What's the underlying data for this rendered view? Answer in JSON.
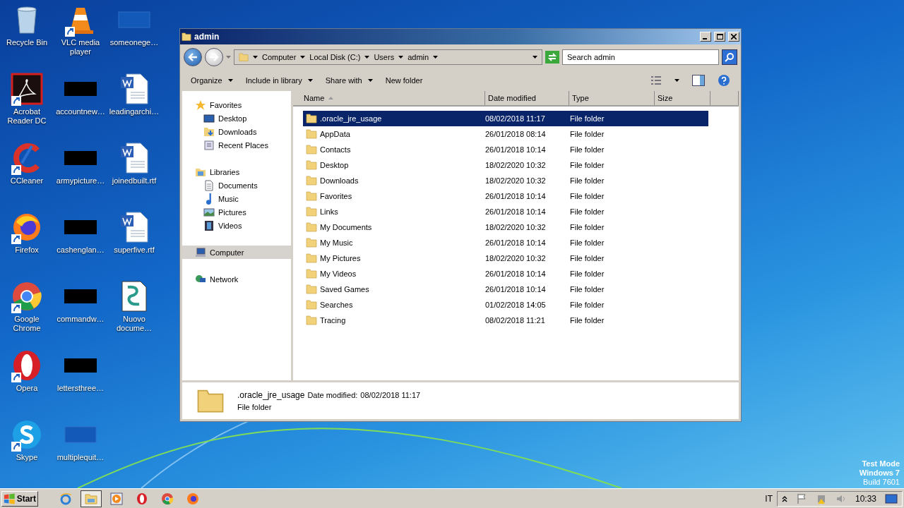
{
  "desktop_icons": [
    {
      "label": "Recycle Bin",
      "kind": "recycle",
      "shortcut": false
    },
    {
      "label": "Acrobat Reader DC",
      "kind": "acrobat",
      "shortcut": true
    },
    {
      "label": "CCleaner",
      "kind": "ccleaner",
      "shortcut": true
    },
    {
      "label": "Firefox",
      "kind": "firefox",
      "shortcut": true
    },
    {
      "label": "Google Chrome",
      "kind": "chrome",
      "shortcut": true
    },
    {
      "label": "Opera",
      "kind": "opera",
      "shortcut": true
    },
    {
      "label": "Skype",
      "kind": "skype",
      "shortcut": true
    },
    {
      "label": "VLC media player",
      "kind": "vlc",
      "shortcut": true
    },
    {
      "label": "accountnew…",
      "kind": "black",
      "shortcut": false
    },
    {
      "label": "armypicture…",
      "kind": "black",
      "shortcut": false
    },
    {
      "label": "cashenglan…",
      "kind": "black",
      "shortcut": false
    },
    {
      "label": "commandw…",
      "kind": "black",
      "shortcut": false
    },
    {
      "label": "lettersthree…",
      "kind": "black",
      "shortcut": false
    },
    {
      "label": "multiplequit…",
      "kind": "blank",
      "shortcut": false
    },
    {
      "label": "someonege…",
      "kind": "blank",
      "shortcut": false
    },
    {
      "label": "leadingarchi…",
      "kind": "word",
      "shortcut": false
    },
    {
      "label": "joinedbuilt.rtf",
      "kind": "word",
      "shortcut": false
    },
    {
      "label": "superfive.rtf",
      "kind": "word",
      "shortcut": false
    },
    {
      "label": "Nuovo docume…",
      "kind": "script",
      "shortcut": false
    }
  ],
  "window": {
    "title": "admin",
    "breadcrumb": [
      "Computer",
      "Local Disk (C:)",
      "Users",
      "admin"
    ],
    "search": {
      "placeholder": "Search admin"
    },
    "toolbar": [
      {
        "label": "Organize",
        "dropdown": true
      },
      {
        "label": "Include in library",
        "dropdown": true
      },
      {
        "label": "Share with",
        "dropdown": true
      },
      {
        "label": "New folder",
        "dropdown": false
      }
    ],
    "nav": [
      {
        "label": "Favorites",
        "kind": "star",
        "selected": false,
        "children": [
          {
            "label": "Desktop",
            "kind": "desktop",
            "selected": false
          },
          {
            "label": "Downloads",
            "kind": "downloads",
            "selected": false
          },
          {
            "label": "Recent Places",
            "kind": "recent",
            "selected": false
          }
        ]
      },
      {
        "label": "Libraries",
        "kind": "library",
        "selected": false,
        "children": [
          {
            "label": "Documents",
            "kind": "document",
            "selected": false
          },
          {
            "label": "Music",
            "kind": "music",
            "selected": false
          },
          {
            "label": "Pictures",
            "kind": "pictures",
            "selected": false
          },
          {
            "label": "Videos",
            "kind": "videos",
            "selected": false
          }
        ]
      },
      {
        "label": "Computer",
        "kind": "computer",
        "selected": true
      },
      {
        "label": "Network",
        "kind": "network",
        "selected": false
      }
    ],
    "columns": [
      {
        "label": "Name",
        "sorted": true
      },
      {
        "label": "Date modified",
        "sorted": false
      },
      {
        "label": "Type",
        "sorted": false
      },
      {
        "label": "Size",
        "sorted": false
      }
    ],
    "rows": [
      {
        "name": ".oracle_jre_usage",
        "date": "08/02/2018 11:17",
        "type": "File folder",
        "selected": true
      },
      {
        "name": "AppData",
        "date": "26/01/2018 08:14",
        "type": "File folder",
        "selected": false
      },
      {
        "name": "Contacts",
        "date": "26/01/2018 10:14",
        "type": "File folder",
        "selected": false
      },
      {
        "name": "Desktop",
        "date": "18/02/2020 10:32",
        "type": "File folder",
        "selected": false
      },
      {
        "name": "Downloads",
        "date": "18/02/2020 10:32",
        "type": "File folder",
        "selected": false
      },
      {
        "name": "Favorites",
        "date": "26/01/2018 10:14",
        "type": "File folder",
        "selected": false
      },
      {
        "name": "Links",
        "date": "26/01/2018 10:14",
        "type": "File folder",
        "selected": false
      },
      {
        "name": "My Documents",
        "date": "18/02/2020 10:32",
        "type": "File folder",
        "selected": false
      },
      {
        "name": "My Music",
        "date": "26/01/2018 10:14",
        "type": "File folder",
        "selected": false
      },
      {
        "name": "My Pictures",
        "date": "18/02/2020 10:32",
        "type": "File folder",
        "selected": false
      },
      {
        "name": "My Videos",
        "date": "26/01/2018 10:14",
        "type": "File folder",
        "selected": false
      },
      {
        "name": "Saved Games",
        "date": "26/01/2018 10:14",
        "type": "File folder",
        "selected": false
      },
      {
        "name": "Searches",
        "date": "01/02/2018 14:05",
        "type": "File folder",
        "selected": false
      },
      {
        "name": "Tracing",
        "date": "08/02/2018 11:21",
        "type": "File folder",
        "selected": false
      }
    ],
    "details": {
      "name": ".oracle_jre_usage",
      "date_label": "Date modified:",
      "date": "08/02/2018 11:17",
      "type": "File folder"
    }
  },
  "watermark_text": [
    "Test Mode",
    "Windows 7",
    "Build 7601"
  ],
  "taskbar": {
    "start": "Start",
    "apps": [
      {
        "kind": "ie",
        "selected": false
      },
      {
        "kind": "explorer",
        "selected": true
      },
      {
        "kind": "media",
        "selected": false
      },
      {
        "kind": "opera",
        "selected": false
      },
      {
        "kind": "chrome",
        "selected": false
      },
      {
        "kind": "firefox",
        "selected": false
      }
    ],
    "language": "IT",
    "clock": "10:33"
  }
}
